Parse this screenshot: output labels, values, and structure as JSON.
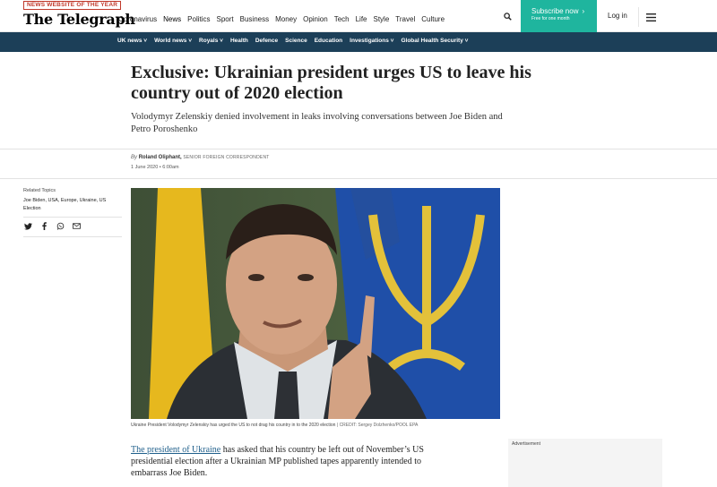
{
  "header": {
    "award_badge": "NEWS WEBSITE OF THE YEAR",
    "logo_text": "The Telegraph",
    "nav_items": [
      "Coronavirus",
      "News",
      "Politics",
      "Sport",
      "Business",
      "Money",
      "Opinion",
      "Tech",
      "Life",
      "Style",
      "Travel",
      "Culture"
    ],
    "subscribe_label": "Subscribe now",
    "subscribe_sub": "Free for one month",
    "login_label": "Log in",
    "accent_color": "#1fb59e"
  },
  "section_nav": {
    "items": [
      "UK news",
      "World news",
      "Royals",
      "Health",
      "Defence",
      "Science",
      "Education",
      "Investigations",
      "Global Health Security"
    ],
    "background": "#1c3f58"
  },
  "article": {
    "headline": "Exclusive: Ukrainian president urges US to leave his country out of 2020 election",
    "standfirst": "Volodymyr Zelenskiy denied involvement in leaks involving conversations between Joe Biden and Petro Poroshenko",
    "byline_prefix": "By",
    "author": "Roland Oliphant,",
    "author_role": "Senior Foreign Correspondent",
    "date": "1 June 2020 • 6:00am",
    "caption": "Ukraine President Volodymyr Zelenskiy has urged the US to not drag his country in to the 2020 election",
    "credit": "CREDIT: Sergey Dolzhenko/POOL EPA",
    "body_link": "The president of Ukraine",
    "body_rest": " has asked that his country be left out of November’s  US presidential election after a Ukrainian MP published tapes apparently intended to embarrass Joe Biden."
  },
  "sidebar": {
    "related_title": "Related Topics",
    "related_tags": "Joe Biden, USA, Europe, Ukraine, US Election",
    "share_icons": [
      "twitter-icon",
      "facebook-icon",
      "whatsapp-icon",
      "email-icon"
    ]
  },
  "ad": {
    "label": "Advertisement"
  }
}
